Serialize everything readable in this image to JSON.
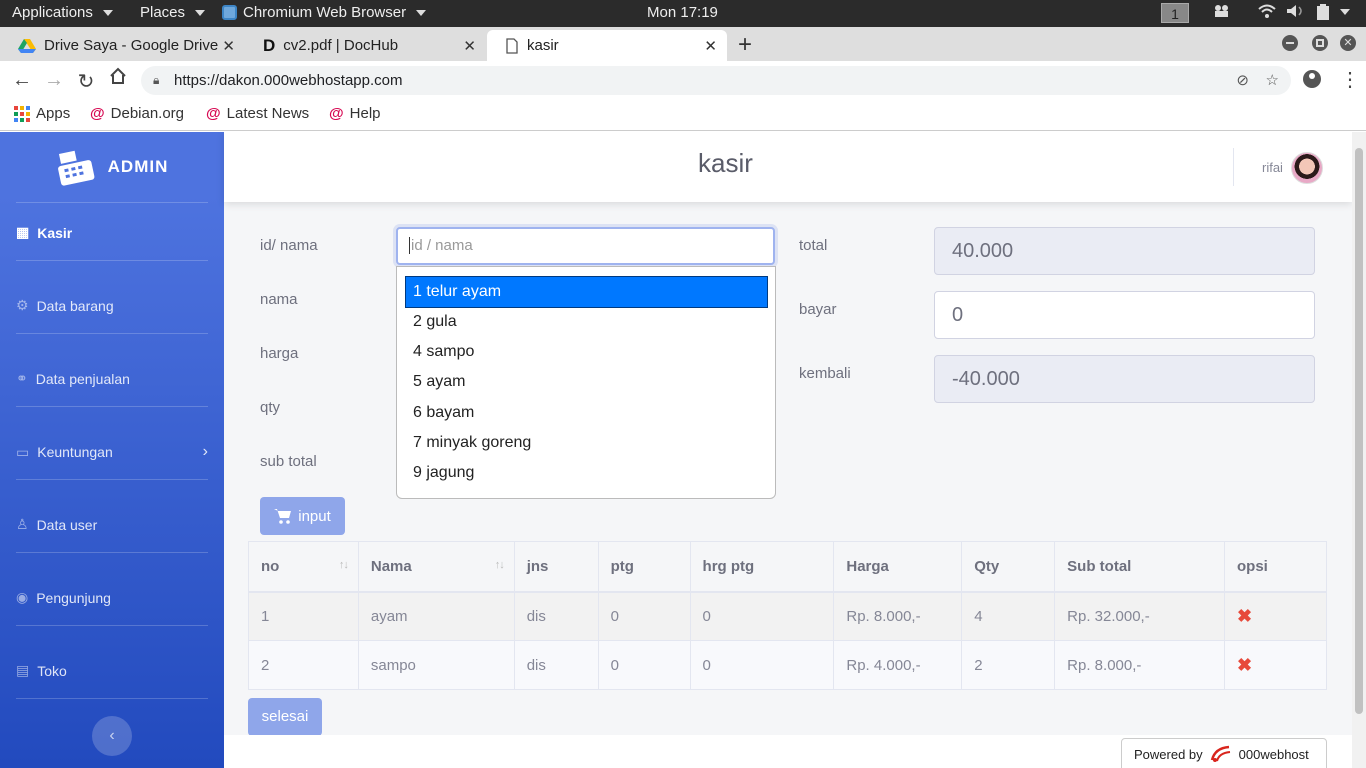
{
  "os_bar": {
    "applications": "Applications",
    "places": "Places",
    "browser_menu": "Chromium Web Browser",
    "clock": "Mon 17:19",
    "workspace": "1"
  },
  "tabs": [
    {
      "title": "Drive Saya - Google Drive"
    },
    {
      "title": "cv2.pdf | DocHub"
    },
    {
      "title": "kasir"
    }
  ],
  "address_bar": {
    "url": "https://dakon.000webhostapp.com"
  },
  "bookmarks": [
    {
      "label": "Apps"
    },
    {
      "label": "Debian.org"
    },
    {
      "label": "Latest News"
    },
    {
      "label": "Help"
    }
  ],
  "sidebar": {
    "brand": "ADMIN",
    "items": [
      {
        "label": "Kasir"
      },
      {
        "label": "Data barang"
      },
      {
        "label": "Data penjualan"
      },
      {
        "label": "Keuntungan"
      },
      {
        "label": "Data user"
      },
      {
        "label": "Pengunjung"
      },
      {
        "label": "Toko"
      }
    ]
  },
  "topbar": {
    "title": "kasir",
    "user": "rifai"
  },
  "form": {
    "id_label": "id/ nama",
    "id_placeholder": "id / nama",
    "nama_label": "nama",
    "harga_label": "harga",
    "qty_label": "qty",
    "subtotal_label": "sub total",
    "total_label": "total",
    "total_value": "40.000",
    "bayar_label": "bayar",
    "bayar_value": "0",
    "kembali_label": "kembali",
    "kembali_value": "-40.000",
    "input_button": "input"
  },
  "dropdown": {
    "options": [
      "1 telur ayam",
      "2 gula",
      "4 sampo",
      "5 ayam",
      "6 bayam",
      "7 minyak goreng",
      "9 jagung"
    ],
    "selected_index": 0
  },
  "table": {
    "headers": [
      "no",
      "Nama",
      "jns",
      "ptg",
      "hrg ptg",
      "Harga",
      "Qty",
      "Sub total",
      "opsi"
    ],
    "rows": [
      [
        "1",
        "ayam",
        "dis",
        "0",
        "0",
        "Rp. 8.000,-",
        "4",
        "Rp. 32.000,-",
        "✖"
      ],
      [
        "2",
        "sampo",
        "dis",
        "0",
        "0",
        "Rp. 4.000,-",
        "2",
        "Rp. 8.000,-",
        "✖"
      ]
    ]
  },
  "selesai_button": "selesai",
  "powered": {
    "prefix": "Powered by",
    "brand": "000webhost"
  },
  "colors": {
    "sidebar_top": "#4e73df",
    "sidebar_bottom": "#224abe",
    "button": "#8fa6ea",
    "delete": "#e74a3b",
    "selected_option": "#0078ff"
  }
}
